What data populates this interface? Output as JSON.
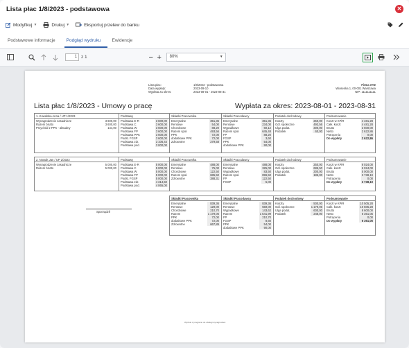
{
  "window": {
    "title": "Lista płac 1/8/2023 - podstawowa"
  },
  "toolbar": {
    "modify_label": "Modyfikuj",
    "print_label": "Drukuj",
    "export_label": "Eksportuj przelew do banku"
  },
  "tabs": [
    {
      "label": "Podstawowe informacje",
      "active": false
    },
    {
      "label": "Podgląd wydruku",
      "active": true
    },
    {
      "label": "Ewidencje",
      "active": false
    }
  ],
  "viewer": {
    "page_value": "1",
    "page_total": "z 1",
    "zoom": "80%"
  },
  "document": {
    "header_labels": [
      "Lista płac:",
      "Data wypłaty:",
      "Wypłata za okres:"
    ],
    "header_values": [
      "1/8/2023 - podstawowa",
      "2023-09-10",
      "2023-08-01 - 2023-08-31"
    ],
    "company": [
      "Firma XYZ",
      "Wiosenka 1, 00-001 Warszawa",
      "NIP: 1111111111"
    ],
    "title": "Lista płac 1/8/2023 - Umowy o pracę",
    "period": "Wypłata za okres: 2023-08-01 - 2023-08-31",
    "column_headers": [
      "Podstawy",
      "Składki Pracownika",
      "Składki Pracodawcy",
      "Podatek dochodowy",
      "Podsumowanie"
    ],
    "employees": [
      {
        "name": "1. Kowalska Anna / UP 1/2023",
        "info_labels": [
          "Wynagrodzenie zasadnicze",
          "Razem brutto",
          "Przychód z PPK - aktualny"
        ],
        "info_values": [
          "3 600,00",
          "3 600,00",
          "144,00"
        ],
        "podstawy_labels": [
          "Podstawa E-R",
          "Podstawa C",
          "Podstawa W",
          "Podstawa FP",
          "Podstawa PPK",
          "Podst. FGSP",
          "Podstawa zdr.",
          "Podstawa pod."
        ],
        "podstawy_values": [
          "3 600,00",
          "3 600,00",
          "3 600,00",
          "3 600,00",
          "3 600,00",
          "3 600,00",
          "3 106,44",
          "3 000,00"
        ],
        "prac_labels": [
          "Emerytalne",
          "Rentowe",
          "Chorobowe",
          "Razem społ.",
          "PPK",
          "dodatkowe PPK",
          "Zdrowotne"
        ],
        "prac_values": [
          "351,36",
          "54,00",
          "88,20",
          "493,56",
          "72,00",
          "72,00",
          "279,58"
        ],
        "pracodawca_labels": [
          "Emerytalne",
          "Rentowe",
          "Wypadkowe",
          "Razem społ.",
          "FP",
          "FGSP",
          "PPK",
          "dodatkowe PPK"
        ],
        "pracodawca_values": [
          "351,36",
          "234,00",
          "60,12",
          "645,48",
          "88,20",
          "3,60",
          "54,00",
          "90,00"
        ],
        "podatek_labels": [
          "Koszty",
          "Odl. społeczne",
          "Ulga podat.",
          "Podatek"
        ],
        "podatek_values": [
          "250,00",
          "493,56",
          "300,00",
          "60,00"
        ],
        "summary_labels": [
          "Koszt w KPiR",
          "Całk. koszt",
          "Brutto",
          "Netto",
          "Potrącenia",
          "Do wypłaty"
        ],
        "summary_values": [
          "4 481,28",
          "4 481,28",
          "3 600,00",
          "2 622,86",
          "0,00",
          "2 622,86"
        ]
      },
      {
        "name": "2. Nowak Jan / UP 2/2023",
        "info_labels": [
          "Wynagrodzenie zasadnicze",
          "Razem brutto"
        ],
        "info_values": [
          "5 000,00",
          "5 000,00"
        ],
        "podstawy_labels": [
          "Podstawa E-R",
          "Podstawa C",
          "Podstawa W",
          "Podstawa FP",
          "Podst. FGSP",
          "Podstawa zdr.",
          "Podstawa pod."
        ],
        "podstawy_values": [
          "5 000,00",
          "5 000,00",
          "5 000,00",
          "5 000,00",
          "5 000,00",
          "4 314,50",
          "4 065,00"
        ],
        "prac_labels": [
          "Emerytalne",
          "Rentowe",
          "Chorobowe",
          "Razem społ.",
          "Zdrowotne"
        ],
        "prac_values": [
          "488,00",
          "75,00",
          "122,50",
          "685,50",
          "388,31"
        ],
        "pracodawca_labels": [
          "Emerytalne",
          "Rentowe",
          "Wypadkowe",
          "Razem społ.",
          "FP",
          "FGSP"
        ],
        "pracodawca_values": [
          "488,00",
          "325,00",
          "83,50",
          "896,50",
          "122,50",
          "5,00"
        ],
        "podatek_labels": [
          "Koszty",
          "Odl. społeczne",
          "Ulga podat.",
          "Podatek"
        ],
        "podatek_values": [
          "250,00",
          "685,50",
          "300,00",
          "186,00"
        ],
        "summary_labels": [
          "Koszt w KPiR",
          "Całk. koszt",
          "Brutto",
          "Netto",
          "Potrącenia",
          "Do wypłaty"
        ],
        "summary_values": [
          "6 024,00",
          "6 024,00",
          "5 000,00",
          "3 738,19",
          "0,00",
          "3 738,19"
        ]
      }
    ],
    "totals": {
      "prac_labels": [
        "Emerytalne",
        "Rentowe",
        "Chorobowe",
        "Razem",
        "PPK",
        "dodatkowe PPK",
        "Zdrowotne"
      ],
      "prac_values": [
        "839,36",
        "129,00",
        "210,70",
        "1 179,06",
        "72,00",
        "72,00",
        "667,89"
      ],
      "pracodawca_labels": [
        "Emerytalne",
        "Rentowe",
        "Wypadkowe",
        "Razem",
        "FP",
        "FGSP",
        "PPK",
        "dodatkowe PPK"
      ],
      "pracodawca_values": [
        "839,36",
        "559,00",
        "143,62",
        "1 541,99",
        "210,70",
        "8,60",
        "54,00",
        "90,00"
      ],
      "podatek_labels": [
        "Koszty",
        "Odl. społeczne",
        "Ulga podat.",
        "Podatek"
      ],
      "podatek_values": [
        "500,00",
        "1 179,06",
        "600,00",
        "248,00"
      ],
      "summary_labels": [
        "Koszt w KPiR",
        "Całk. koszt",
        "Brutto",
        "Netto",
        "Potrącenia",
        "Do wypłaty"
      ],
      "summary_values": [
        "10 505,28",
        "10 505,28",
        "8 600,00",
        "6 361,05",
        "0,00",
        "6 361,05"
      ]
    },
    "signature_label": "Sporządził",
    "footer_note": "Wydruk z programu do obsługi wynagrodzeń"
  }
}
